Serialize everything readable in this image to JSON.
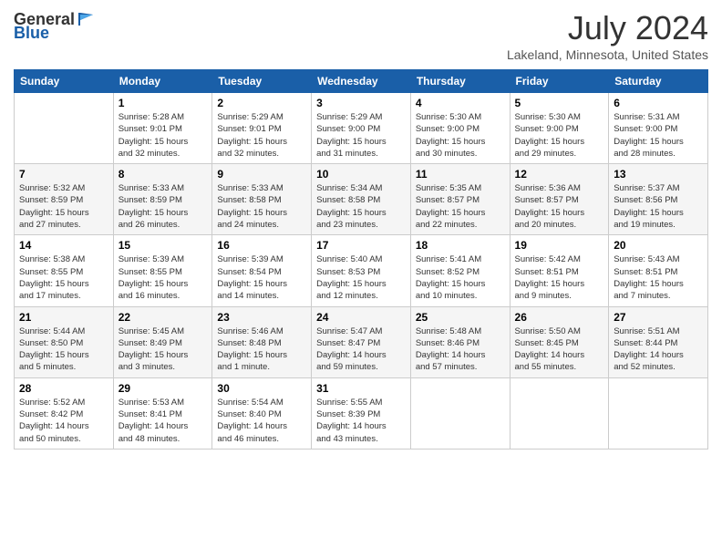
{
  "header": {
    "logo_general": "General",
    "logo_blue": "Blue",
    "title": "July 2024",
    "subtitle": "Lakeland, Minnesota, United States"
  },
  "days_of_week": [
    "Sunday",
    "Monday",
    "Tuesday",
    "Wednesday",
    "Thursday",
    "Friday",
    "Saturday"
  ],
  "weeks": [
    [
      {
        "day": "",
        "info": ""
      },
      {
        "day": "1",
        "info": "Sunrise: 5:28 AM\nSunset: 9:01 PM\nDaylight: 15 hours\nand 32 minutes."
      },
      {
        "day": "2",
        "info": "Sunrise: 5:29 AM\nSunset: 9:01 PM\nDaylight: 15 hours\nand 32 minutes."
      },
      {
        "day": "3",
        "info": "Sunrise: 5:29 AM\nSunset: 9:00 PM\nDaylight: 15 hours\nand 31 minutes."
      },
      {
        "day": "4",
        "info": "Sunrise: 5:30 AM\nSunset: 9:00 PM\nDaylight: 15 hours\nand 30 minutes."
      },
      {
        "day": "5",
        "info": "Sunrise: 5:30 AM\nSunset: 9:00 PM\nDaylight: 15 hours\nand 29 minutes."
      },
      {
        "day": "6",
        "info": "Sunrise: 5:31 AM\nSunset: 9:00 PM\nDaylight: 15 hours\nand 28 minutes."
      }
    ],
    [
      {
        "day": "7",
        "info": "Sunrise: 5:32 AM\nSunset: 8:59 PM\nDaylight: 15 hours\nand 27 minutes."
      },
      {
        "day": "8",
        "info": "Sunrise: 5:33 AM\nSunset: 8:59 PM\nDaylight: 15 hours\nand 26 minutes."
      },
      {
        "day": "9",
        "info": "Sunrise: 5:33 AM\nSunset: 8:58 PM\nDaylight: 15 hours\nand 24 minutes."
      },
      {
        "day": "10",
        "info": "Sunrise: 5:34 AM\nSunset: 8:58 PM\nDaylight: 15 hours\nand 23 minutes."
      },
      {
        "day": "11",
        "info": "Sunrise: 5:35 AM\nSunset: 8:57 PM\nDaylight: 15 hours\nand 22 minutes."
      },
      {
        "day": "12",
        "info": "Sunrise: 5:36 AM\nSunset: 8:57 PM\nDaylight: 15 hours\nand 20 minutes."
      },
      {
        "day": "13",
        "info": "Sunrise: 5:37 AM\nSunset: 8:56 PM\nDaylight: 15 hours\nand 19 minutes."
      }
    ],
    [
      {
        "day": "14",
        "info": "Sunrise: 5:38 AM\nSunset: 8:55 PM\nDaylight: 15 hours\nand 17 minutes."
      },
      {
        "day": "15",
        "info": "Sunrise: 5:39 AM\nSunset: 8:55 PM\nDaylight: 15 hours\nand 16 minutes."
      },
      {
        "day": "16",
        "info": "Sunrise: 5:39 AM\nSunset: 8:54 PM\nDaylight: 15 hours\nand 14 minutes."
      },
      {
        "day": "17",
        "info": "Sunrise: 5:40 AM\nSunset: 8:53 PM\nDaylight: 15 hours\nand 12 minutes."
      },
      {
        "day": "18",
        "info": "Sunrise: 5:41 AM\nSunset: 8:52 PM\nDaylight: 15 hours\nand 10 minutes."
      },
      {
        "day": "19",
        "info": "Sunrise: 5:42 AM\nSunset: 8:51 PM\nDaylight: 15 hours\nand 9 minutes."
      },
      {
        "day": "20",
        "info": "Sunrise: 5:43 AM\nSunset: 8:51 PM\nDaylight: 15 hours\nand 7 minutes."
      }
    ],
    [
      {
        "day": "21",
        "info": "Sunrise: 5:44 AM\nSunset: 8:50 PM\nDaylight: 15 hours\nand 5 minutes."
      },
      {
        "day": "22",
        "info": "Sunrise: 5:45 AM\nSunset: 8:49 PM\nDaylight: 15 hours\nand 3 minutes."
      },
      {
        "day": "23",
        "info": "Sunrise: 5:46 AM\nSunset: 8:48 PM\nDaylight: 15 hours\nand 1 minute."
      },
      {
        "day": "24",
        "info": "Sunrise: 5:47 AM\nSunset: 8:47 PM\nDaylight: 14 hours\nand 59 minutes."
      },
      {
        "day": "25",
        "info": "Sunrise: 5:48 AM\nSunset: 8:46 PM\nDaylight: 14 hours\nand 57 minutes."
      },
      {
        "day": "26",
        "info": "Sunrise: 5:50 AM\nSunset: 8:45 PM\nDaylight: 14 hours\nand 55 minutes."
      },
      {
        "day": "27",
        "info": "Sunrise: 5:51 AM\nSunset: 8:44 PM\nDaylight: 14 hours\nand 52 minutes."
      }
    ],
    [
      {
        "day": "28",
        "info": "Sunrise: 5:52 AM\nSunset: 8:42 PM\nDaylight: 14 hours\nand 50 minutes."
      },
      {
        "day": "29",
        "info": "Sunrise: 5:53 AM\nSunset: 8:41 PM\nDaylight: 14 hours\nand 48 minutes."
      },
      {
        "day": "30",
        "info": "Sunrise: 5:54 AM\nSunset: 8:40 PM\nDaylight: 14 hours\nand 46 minutes."
      },
      {
        "day": "31",
        "info": "Sunrise: 5:55 AM\nSunset: 8:39 PM\nDaylight: 14 hours\nand 43 minutes."
      },
      {
        "day": "",
        "info": ""
      },
      {
        "day": "",
        "info": ""
      },
      {
        "day": "",
        "info": ""
      }
    ]
  ]
}
